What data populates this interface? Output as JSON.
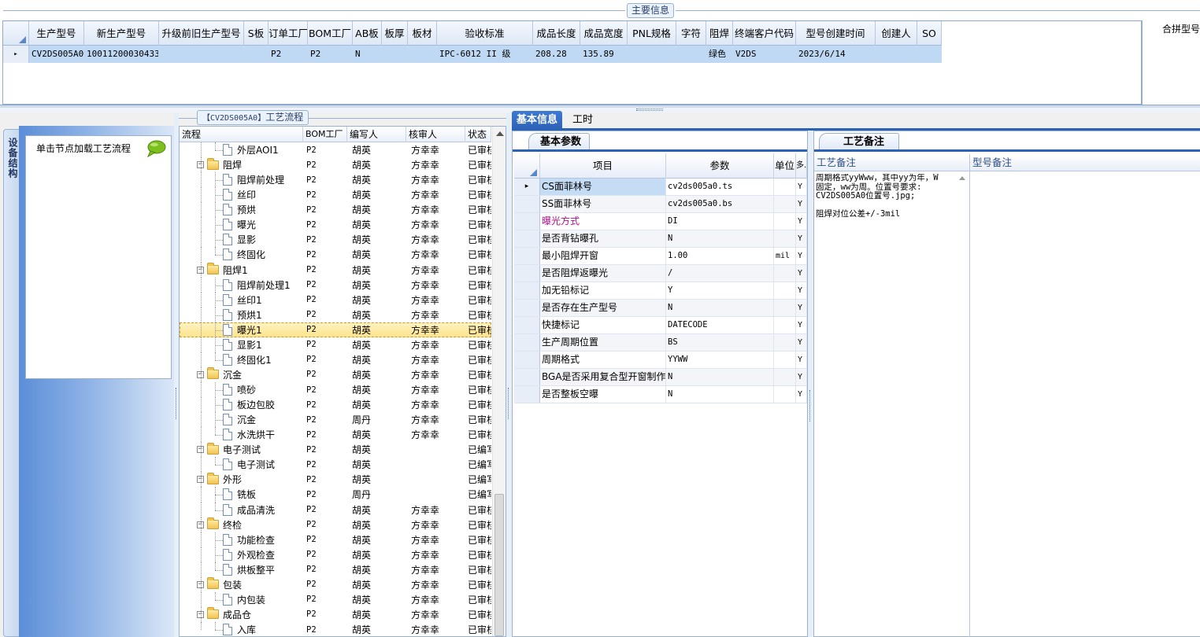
{
  "top": {
    "group_title": "主要信息",
    "columns": [
      "生产型号",
      "新生产型号",
      "升级前旧生产型号",
      "S板",
      "订单工厂",
      "BOM工厂",
      "AB板",
      "板厚",
      "板材",
      "验收标准",
      "成品长度",
      "成品宽度",
      "PNL规格",
      "字符",
      "阻焊",
      "终端客户代码",
      "型号创建时间",
      "创建人",
      "SO"
    ],
    "row": [
      "CV2DS005A0",
      "10011200030433",
      "",
      "",
      "P2",
      "P2",
      "N",
      "",
      "",
      "IPC-6012 II 级",
      "208.28",
      "135.89",
      "",
      "",
      "绿色",
      "V2DS",
      "2023/6/14",
      "",
      ""
    ],
    "row_marker": "▸",
    "merge_header": "合拼型号"
  },
  "side": {
    "tab_label": "设备结构",
    "hint": "单击节点加载工艺流程",
    "chat_icon": "speech-bubble-icon"
  },
  "tree": {
    "title_code": "【CV2DS005A0】",
    "title_text": "工艺流程",
    "columns": [
      "流程",
      "BOM工厂",
      "编写人",
      "核审人",
      "状态"
    ],
    "rows": [
      {
        "name": "外层AOI1",
        "level": 2,
        "bom": "P2",
        "writer": "胡英",
        "reviewer": "方幸幸",
        "status": "已审核"
      },
      {
        "name": "阻焊",
        "level": 1,
        "bom": "P2",
        "writer": "胡英",
        "reviewer": "方幸幸",
        "status": "已审核"
      },
      {
        "name": "阻焊前处理",
        "level": 2,
        "bom": "P2",
        "writer": "胡英",
        "reviewer": "方幸幸",
        "status": "已审核"
      },
      {
        "name": "丝印",
        "level": 2,
        "bom": "P2",
        "writer": "胡英",
        "reviewer": "方幸幸",
        "status": "已审核"
      },
      {
        "name": "预烘",
        "level": 2,
        "bom": "P2",
        "writer": "胡英",
        "reviewer": "方幸幸",
        "status": "已审核"
      },
      {
        "name": "曝光",
        "level": 2,
        "bom": "P2",
        "writer": "胡英",
        "reviewer": "方幸幸",
        "status": "已审核"
      },
      {
        "name": "显影",
        "level": 2,
        "bom": "P2",
        "writer": "胡英",
        "reviewer": "方幸幸",
        "status": "已审核"
      },
      {
        "name": "终固化",
        "level": 2,
        "bom": "P2",
        "writer": "胡英",
        "reviewer": "方幸幸",
        "status": "已审核"
      },
      {
        "name": "阻焊1",
        "level": 1,
        "bom": "P2",
        "writer": "胡英",
        "reviewer": "方幸幸",
        "status": "已审核"
      },
      {
        "name": "阻焊前处理1",
        "level": 2,
        "bom": "P2",
        "writer": "胡英",
        "reviewer": "方幸幸",
        "status": "已审核"
      },
      {
        "name": "丝印1",
        "level": 2,
        "bom": "P2",
        "writer": "胡英",
        "reviewer": "方幸幸",
        "status": "已审核"
      },
      {
        "name": "预烘1",
        "level": 2,
        "bom": "P2",
        "writer": "胡英",
        "reviewer": "方幸幸",
        "status": "已审核"
      },
      {
        "name": "曝光1",
        "level": 2,
        "bom": "P2",
        "writer": "胡英",
        "reviewer": "方幸幸",
        "status": "已审核",
        "selected": true
      },
      {
        "name": "显影1",
        "level": 2,
        "bom": "P2",
        "writer": "胡英",
        "reviewer": "方幸幸",
        "status": "已审核"
      },
      {
        "name": "终固化1",
        "level": 2,
        "bom": "P2",
        "writer": "胡英",
        "reviewer": "方幸幸",
        "status": "已审核"
      },
      {
        "name": "沉金",
        "level": 1,
        "bom": "P2",
        "writer": "胡英",
        "reviewer": "方幸幸",
        "status": "已审核"
      },
      {
        "name": "喷砂",
        "level": 2,
        "bom": "P2",
        "writer": "胡英",
        "reviewer": "方幸幸",
        "status": "已审核"
      },
      {
        "name": "板边包胶",
        "level": 2,
        "bom": "P2",
        "writer": "胡英",
        "reviewer": "方幸幸",
        "status": "已审核"
      },
      {
        "name": "沉金",
        "level": 2,
        "bom": "P2",
        "writer": "周丹",
        "reviewer": "方幸幸",
        "status": "已审核"
      },
      {
        "name": "水洗烘干",
        "level": 2,
        "bom": "P2",
        "writer": "胡英",
        "reviewer": "方幸幸",
        "status": "已审核"
      },
      {
        "name": "电子测试",
        "level": 1,
        "bom": "P2",
        "writer": "胡英",
        "reviewer": "",
        "status": "已编写"
      },
      {
        "name": "电子测试",
        "level": 2,
        "bom": "P2",
        "writer": "胡英",
        "reviewer": "",
        "status": "已编写"
      },
      {
        "name": "外形",
        "level": 1,
        "bom": "P2",
        "writer": "胡英",
        "reviewer": "",
        "status": "已编写"
      },
      {
        "name": "铣板",
        "level": 2,
        "bom": "P2",
        "writer": "周丹",
        "reviewer": "",
        "status": "已编写"
      },
      {
        "name": "成品清洗",
        "level": 2,
        "bom": "P2",
        "writer": "胡英",
        "reviewer": "方幸幸",
        "status": "已审核"
      },
      {
        "name": "终检",
        "level": 1,
        "bom": "P2",
        "writer": "胡英",
        "reviewer": "方幸幸",
        "status": "已审核"
      },
      {
        "name": "功能检查",
        "level": 2,
        "bom": "P2",
        "writer": "胡英",
        "reviewer": "方幸幸",
        "status": "已审核"
      },
      {
        "name": "外观检查",
        "level": 2,
        "bom": "P2",
        "writer": "胡英",
        "reviewer": "方幸幸",
        "status": "已审核"
      },
      {
        "name": "烘板整平",
        "level": 2,
        "bom": "P2",
        "writer": "胡英",
        "reviewer": "方幸幸",
        "status": "已审核"
      },
      {
        "name": "包装",
        "level": 1,
        "bom": "P2",
        "writer": "胡英",
        "reviewer": "方幸幸",
        "status": "已审核"
      },
      {
        "name": "内包装",
        "level": 2,
        "bom": "P2",
        "writer": "胡英",
        "reviewer": "方幸幸",
        "status": "已审核"
      },
      {
        "name": "成品仓",
        "level": 1,
        "bom": "P2",
        "writer": "胡英",
        "reviewer": "方幸幸",
        "status": "已审核"
      },
      {
        "name": "入库",
        "level": 2,
        "bom": "P2",
        "writer": "胡英",
        "reviewer": "方幸幸",
        "status": "已审核"
      }
    ]
  },
  "tabs": {
    "basic": "基本信息",
    "hours": "工时"
  },
  "params": {
    "sub_tab": "基本参数",
    "columns": [
      "项目",
      "参数",
      "单位",
      "多."
    ],
    "row_marker": "▸",
    "rows": [
      {
        "item": "CS面菲林号",
        "param": "cv2ds005a0.ts",
        "unit": "",
        "flag": "Y"
      },
      {
        "item": "SS面菲林号",
        "param": "cv2ds005a0.bs",
        "unit": "",
        "flag": "Y"
      },
      {
        "item": "曝光方式",
        "param": "DI",
        "unit": "",
        "flag": "Y"
      },
      {
        "item": "是否背钻曝孔",
        "param": "N",
        "unit": "",
        "flag": "Y"
      },
      {
        "item": "最小阻焊开窗",
        "param": "1.00",
        "unit": "mil",
        "flag": "Y"
      },
      {
        "item": "是否阻焊返曝光",
        "param": "/",
        "unit": "",
        "flag": "Y"
      },
      {
        "item": "加无铅标记",
        "param": "Y",
        "unit": "",
        "flag": "Y"
      },
      {
        "item": "是否存在生产型号",
        "param": "N",
        "unit": "",
        "flag": "Y"
      },
      {
        "item": "快捷标记",
        "param": "DATECODE",
        "unit": "",
        "flag": "Y"
      },
      {
        "item": "生产周期位置",
        "param": "BS",
        "unit": "",
        "flag": "Y"
      },
      {
        "item": "周期格式",
        "param": "YYWW",
        "unit": "",
        "flag": "Y"
      },
      {
        "item": "BGA是否采用复合型开窗制作",
        "param": "N",
        "unit": "",
        "flag": "Y"
      },
      {
        "item": "是否整板空曝",
        "param": "N",
        "unit": "",
        "flag": "Y"
      }
    ]
  },
  "notes": {
    "sub_tab": "工艺备注",
    "col_process": "工艺备注",
    "col_model": "型号备注",
    "process_text": "周期格式yyWww，其中yy为年，W\n固定，ww为周。位置号要求:\nCV2DS005A0位置号.jpg;\n\n阻焊对位公差+/-3mil"
  },
  "colors": {
    "accent": "#2c62b6",
    "selected_row": "#bfd9f5",
    "tree_selected": "#fde38a",
    "highlight_text": "#b0108a"
  }
}
